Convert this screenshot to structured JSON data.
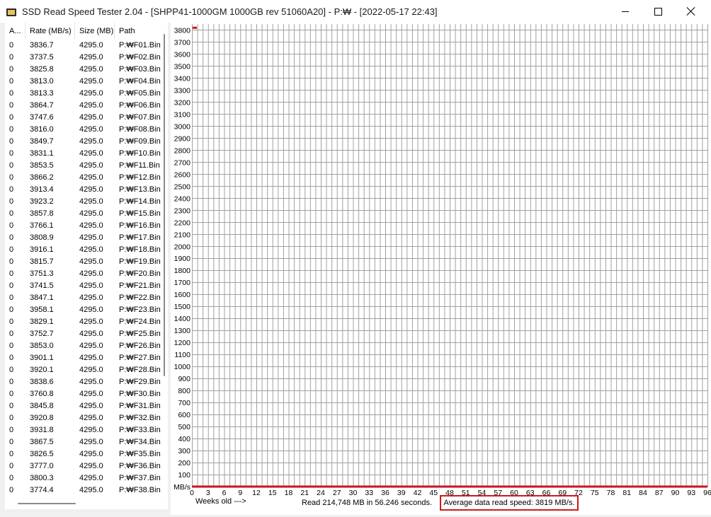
{
  "window": {
    "title": "SSD Read Speed Tester 2.04 - [SHPP41-1000GM 1000GB rev 51060A20] - P:₩ - [2022-05-17 22:43]"
  },
  "list": {
    "headers": [
      "A...",
      "Rate (MB/s)",
      "Size (MB)",
      "Path"
    ],
    "rows": [
      [
        "0",
        "3836.7",
        "4295.0",
        "P:₩F01.Bin"
      ],
      [
        "0",
        "3737.5",
        "4295.0",
        "P:₩F02.Bin"
      ],
      [
        "0",
        "3825.8",
        "4295.0",
        "P:₩F03.Bin"
      ],
      [
        "0",
        "3813.0",
        "4295.0",
        "P:₩F04.Bin"
      ],
      [
        "0",
        "3813.3",
        "4295.0",
        "P:₩F05.Bin"
      ],
      [
        "0",
        "3864.7",
        "4295.0",
        "P:₩F06.Bin"
      ],
      [
        "0",
        "3747.6",
        "4295.0",
        "P:₩F07.Bin"
      ],
      [
        "0",
        "3816.0",
        "4295.0",
        "P:₩F08.Bin"
      ],
      [
        "0",
        "3849.7",
        "4295.0",
        "P:₩F09.Bin"
      ],
      [
        "0",
        "3831.1",
        "4295.0",
        "P:₩F10.Bin"
      ],
      [
        "0",
        "3853.5",
        "4295.0",
        "P:₩F11.Bin"
      ],
      [
        "0",
        "3866.2",
        "4295.0",
        "P:₩F12.Bin"
      ],
      [
        "0",
        "3913.4",
        "4295.0",
        "P:₩F13.Bin"
      ],
      [
        "0",
        "3923.2",
        "4295.0",
        "P:₩F14.Bin"
      ],
      [
        "0",
        "3857.8",
        "4295.0",
        "P:₩F15.Bin"
      ],
      [
        "0",
        "3766.1",
        "4295.0",
        "P:₩F16.Bin"
      ],
      [
        "0",
        "3808.9",
        "4295.0",
        "P:₩F17.Bin"
      ],
      [
        "0",
        "3916.1",
        "4295.0",
        "P:₩F18.Bin"
      ],
      [
        "0",
        "3815.7",
        "4295.0",
        "P:₩F19.Bin"
      ],
      [
        "0",
        "3751.3",
        "4295.0",
        "P:₩F20.Bin"
      ],
      [
        "0",
        "3741.5",
        "4295.0",
        "P:₩F21.Bin"
      ],
      [
        "0",
        "3847.1",
        "4295.0",
        "P:₩F22.Bin"
      ],
      [
        "0",
        "3958.1",
        "4295.0",
        "P:₩F23.Bin"
      ],
      [
        "0",
        "3829.1",
        "4295.0",
        "P:₩F24.Bin"
      ],
      [
        "0",
        "3752.7",
        "4295.0",
        "P:₩F25.Bin"
      ],
      [
        "0",
        "3853.0",
        "4295.0",
        "P:₩F26.Bin"
      ],
      [
        "0",
        "3901.1",
        "4295.0",
        "P:₩F27.Bin"
      ],
      [
        "0",
        "3920.1",
        "4295.0",
        "P:₩F28.Bin"
      ],
      [
        "0",
        "3838.6",
        "4295.0",
        "P:₩F29.Bin"
      ],
      [
        "0",
        "3760.8",
        "4295.0",
        "P:₩F30.Bin"
      ],
      [
        "0",
        "3845.8",
        "4295.0",
        "P:₩F31.Bin"
      ],
      [
        "0",
        "3920.8",
        "4295.0",
        "P:₩F32.Bin"
      ],
      [
        "0",
        "3931.8",
        "4295.0",
        "P:₩F33.Bin"
      ],
      [
        "0",
        "3867.5",
        "4295.0",
        "P:₩F34.Bin"
      ],
      [
        "0",
        "3826.5",
        "4295.0",
        "P:₩F35.Bin"
      ],
      [
        "0",
        "3777.0",
        "4295.0",
        "P:₩F36.Bin"
      ],
      [
        "0",
        "3800.3",
        "4295.0",
        "P:₩F37.Bin"
      ],
      [
        "0",
        "3774.4",
        "4295.0",
        "P:₩F38.Bin"
      ]
    ]
  },
  "chart": {
    "y_unit_label": "MB/s",
    "x_caption": "Weeks old --->",
    "read_summary": "Read 214,748 MB in 56.246 seconds.",
    "average_summary": "Average data read speed: 3819 MB/s.",
    "colors": {
      "grid": "#a0a0a0",
      "series": "#cc1122",
      "highlight_box": "#d01818"
    }
  },
  "chart_data": {
    "type": "line",
    "xlabel": "Weeks old --->",
    "ylabel": "MB/s",
    "x_ticks": [
      0,
      3,
      6,
      9,
      12,
      15,
      18,
      21,
      24,
      27,
      30,
      33,
      36,
      39,
      42,
      45,
      48,
      51,
      54,
      57,
      60,
      63,
      66,
      69,
      72,
      75,
      78,
      81,
      84,
      87,
      90,
      93,
      96
    ],
    "y_ticks": [
      100,
      200,
      300,
      400,
      500,
      600,
      700,
      800,
      900,
      1000,
      1100,
      1200,
      1300,
      1400,
      1500,
      1600,
      1700,
      1800,
      1900,
      2000,
      2100,
      2200,
      2300,
      2400,
      2500,
      2600,
      2700,
      2800,
      2900,
      3000,
      3100,
      3200,
      3300,
      3400,
      3500,
      3600,
      3700,
      3800
    ],
    "xlim": [
      0,
      96
    ],
    "ylim": [
      0,
      3850
    ],
    "grid": true,
    "series": [
      {
        "x": [
          0
        ],
        "y": [
          3819
        ]
      }
    ]
  }
}
